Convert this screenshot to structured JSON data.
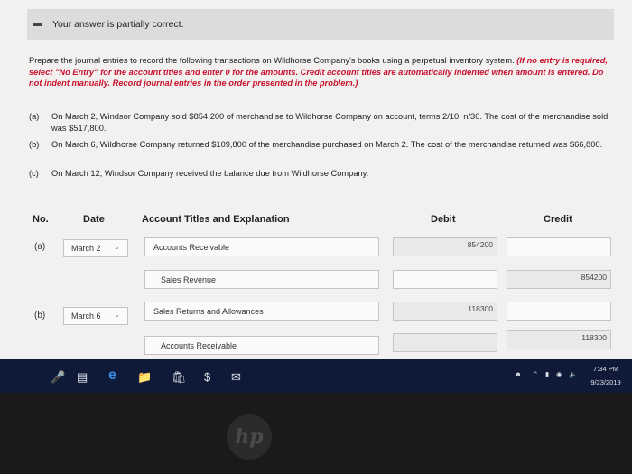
{
  "status": {
    "message": "Your answer is partially correct."
  },
  "instructions": {
    "main": "Prepare the journal entries to record the following transactions on Wildhorse Company's books using a perpetual inventory system.",
    "note": "(If no entry is required, select \"No Entry\" for the account titles and enter 0 for the amounts. Credit account titles are automatically indented when amount is entered. Do not indent manually. Record journal entries in the order presented in the problem.)"
  },
  "transactions": [
    {
      "label": "(a)",
      "text": "On March 2, Windsor Company sold $854,200 of merchandise to Wildhorse Company on account, terms 2/10, n/30. The cost of the merchandise sold was $517,800."
    },
    {
      "label": "(b)",
      "text": "On March 6, Wildhorse Company returned $109,800 of the merchandise purchased on March 2. The cost of the merchandise returned was $66,800."
    },
    {
      "label": "(c)",
      "text": "On March 12, Windsor Company received the balance due from Wildhorse Company."
    }
  ],
  "table": {
    "headers": {
      "no": "No.",
      "date": "Date",
      "account": "Account Titles and Explanation",
      "debit": "Debit",
      "credit": "Credit"
    },
    "rows": [
      {
        "no": "(a)",
        "date": "March 2",
        "account": "Accounts Receivable",
        "debit": "854200",
        "credit": ""
      },
      {
        "no": "",
        "date": "",
        "account": "Sales Revenue",
        "debit": "",
        "credit": "854200"
      },
      {
        "no": "(b)",
        "date": "March 6",
        "account": "Sales Returns and Allowances",
        "debit": "118300",
        "credit": ""
      },
      {
        "no": "",
        "date": "",
        "account": "Accounts Receivable",
        "debit": "",
        "credit": "118300"
      }
    ]
  },
  "taskbar": {
    "time": "7:34 PM",
    "date": "9/23/2019"
  },
  "device": {
    "logo": "hp"
  }
}
